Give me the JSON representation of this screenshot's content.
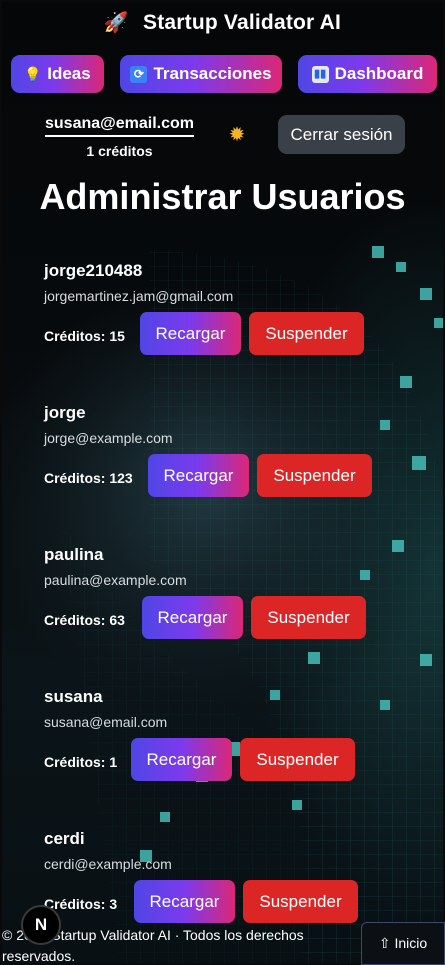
{
  "app": {
    "title": "Startup Validator AI",
    "logo_icon": "rocket-icon"
  },
  "nav": [
    {
      "label": "Ideas",
      "icon": "lightbulb-icon"
    },
    {
      "label": "Transacciones",
      "icon": "refresh-icon"
    },
    {
      "label": "Dashboard",
      "icon": "bar-chart-icon"
    }
  ],
  "account": {
    "email": "susana@email.com",
    "credits": "1 créditos",
    "theme_icon": "sun-icon",
    "logout_label": "Cerrar sesión"
  },
  "page_title": "Administrar Usuarios",
  "users": [
    {
      "name": "jorge210488",
      "email": "jorgemartinez.jam@gmail.com",
      "credits": "Créditos: 15",
      "recharge_label": "Recargar",
      "suspend_label": "Suspender"
    },
    {
      "name": "jorge",
      "email": "jorge@example.com",
      "credits": "Créditos: 123",
      "recharge_label": "Recargar",
      "suspend_label": "Suspender"
    },
    {
      "name": "paulina",
      "email": "paulina@example.com",
      "credits": "Créditos: 63",
      "recharge_label": "Recargar",
      "suspend_label": "Suspender"
    },
    {
      "name": "susana",
      "email": "susana@email.com",
      "credits": "Créditos: 1",
      "recharge_label": "Recargar",
      "suspend_label": "Suspender"
    },
    {
      "name": "cerdi",
      "email": "cerdi@example.com",
      "credits": "Créditos: 3",
      "recharge_label": "Recargar",
      "suspend_label": "Suspender"
    }
  ],
  "footer": {
    "copyright": "© 2025 Startup Validator AI · Todos los derechos reservados.",
    "home_label": "⇧ Inicio",
    "framework_badge": "N"
  },
  "colors": {
    "accent_gradient_start": "#4f46e5",
    "accent_gradient_end": "#db2777",
    "danger": "#dc2626",
    "background": "#05090c"
  }
}
